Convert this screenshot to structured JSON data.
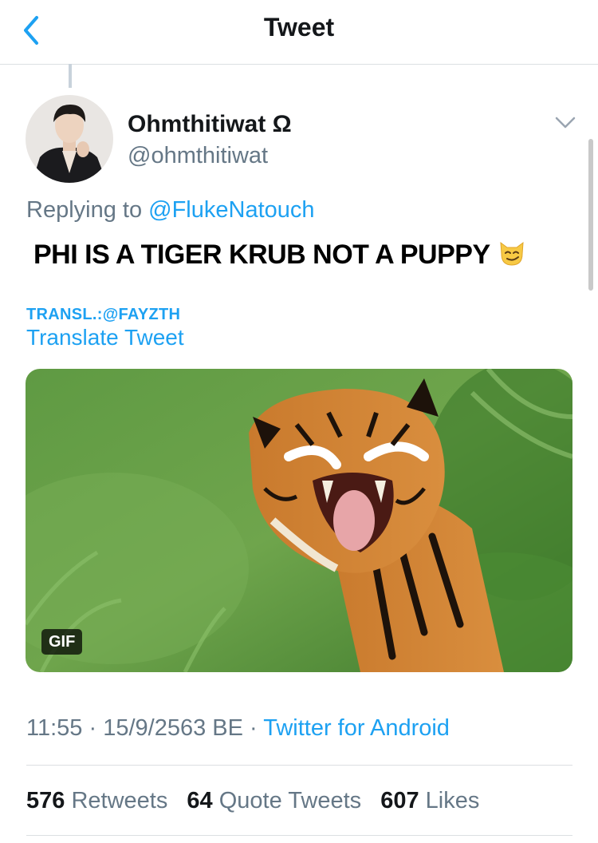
{
  "header": {
    "title": "Tweet",
    "back_icon": "chevron-left-icon"
  },
  "author": {
    "name": "Ohmthitiwat Ω",
    "handle": "@ohmthitiwat"
  },
  "tweet": {
    "replying_prefix": "Replying to",
    "replying_to": "@FlukeNatouch",
    "text": "PHI IS A TIGER KRUB NOT A PUPPY",
    "emoji": "smirking-cat-face-icon",
    "translation_credit": "TRANSL.:@FAYZTH",
    "translate_link": "Translate Tweet",
    "media_badge": "GIF"
  },
  "meta": {
    "time": "11:55",
    "separator": " · ",
    "date": "15/9/2563 BE",
    "source": "Twitter for Android"
  },
  "stats": {
    "retweets_count": "576",
    "retweets_label": "Retweets",
    "quotes_count": "64",
    "quotes_label": "Quote Tweets",
    "likes_count": "607",
    "likes_label": "Likes"
  },
  "colors": {
    "accent": "#1da1f2",
    "secondary_text": "#657786",
    "divider": "#dcdfe2"
  }
}
